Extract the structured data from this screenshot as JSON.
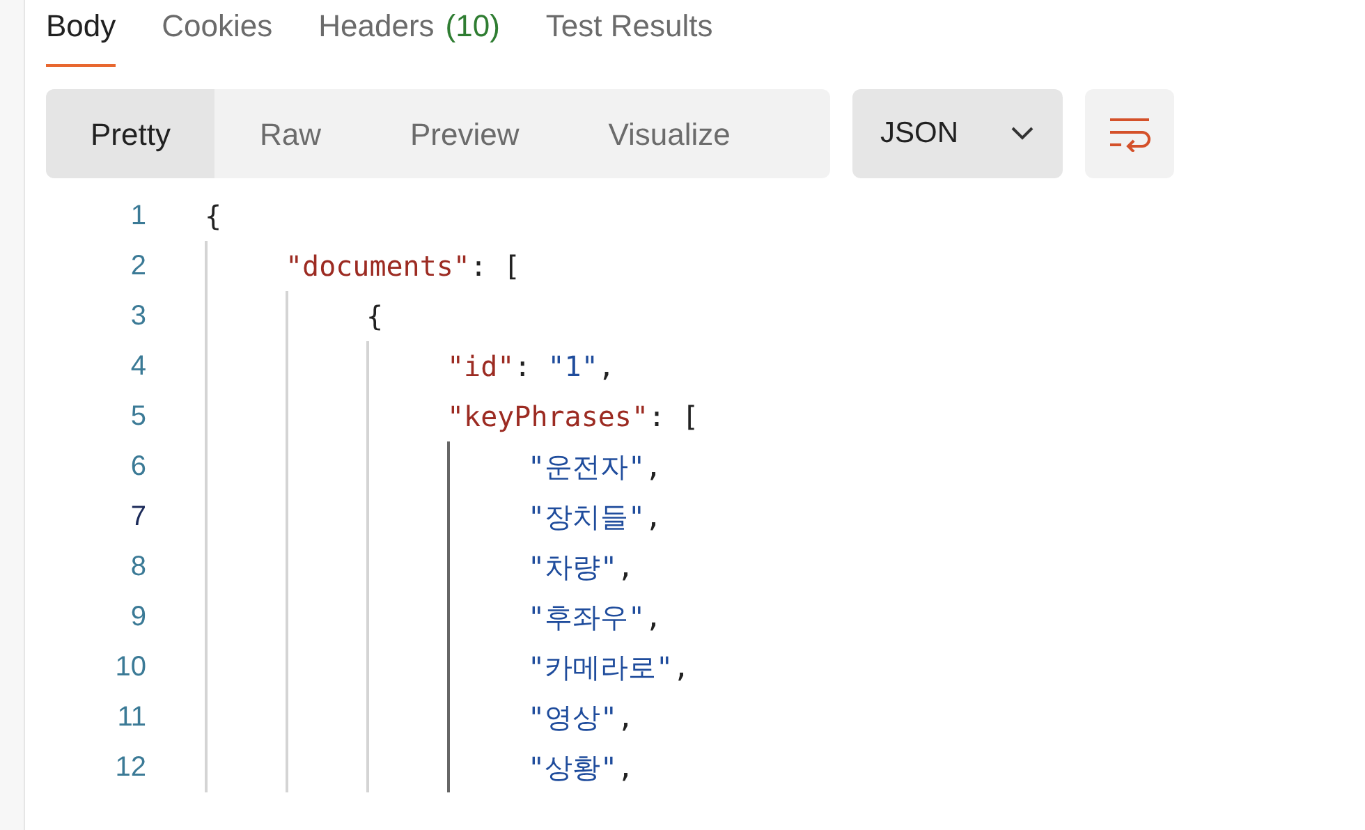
{
  "tabs": [
    {
      "label": "Body",
      "selected": true
    },
    {
      "label": "Cookies",
      "selected": false
    },
    {
      "label": "Headers",
      "count": "(10)",
      "selected": false
    },
    {
      "label": "Test Results",
      "selected": false
    }
  ],
  "view_modes": [
    {
      "label": "Pretty",
      "selected": true
    },
    {
      "label": "Raw",
      "selected": false
    },
    {
      "label": "Preview",
      "selected": false
    },
    {
      "label": "Visualize",
      "selected": false
    }
  ],
  "format_dropdown": {
    "value": "JSON"
  },
  "code": [
    {
      "number": "1",
      "current": false,
      "tokens": [
        {
          "kind": "punct",
          "text": "{"
        }
      ],
      "children": [
        {
          "number": "2",
          "current": false,
          "tokens": [
            {
              "kind": "key",
              "text": "\"documents\""
            },
            {
              "kind": "punct",
              "text": ": ["
            }
          ],
          "children": [
            {
              "number": "3",
              "current": false,
              "tokens": [
                {
                  "kind": "punct",
                  "text": "{"
                }
              ],
              "children": [
                {
                  "number": "4",
                  "current": false,
                  "tokens": [
                    {
                      "kind": "key",
                      "text": "\"id\""
                    },
                    {
                      "kind": "punct",
                      "text": ": "
                    },
                    {
                      "kind": "string",
                      "text": "\"1\""
                    },
                    {
                      "kind": "punct",
                      "text": ","
                    }
                  ]
                },
                {
                  "number": "5",
                  "current": false,
                  "tokens": [
                    {
                      "kind": "key",
                      "text": "\"keyPhrases\""
                    },
                    {
                      "kind": "punct",
                      "text": ": ["
                    }
                  ],
                  "children": [
                    {
                      "number": "6",
                      "current": false,
                      "tokens": [
                        {
                          "kind": "string",
                          "text": "\"운전자\""
                        },
                        {
                          "kind": "punct",
                          "text": ","
                        }
                      ]
                    },
                    {
                      "number": "7",
                      "current": true,
                      "tokens": [
                        {
                          "kind": "string",
                          "text": "\"장치들\""
                        },
                        {
                          "kind": "punct",
                          "text": ","
                        }
                      ]
                    },
                    {
                      "number": "8",
                      "current": false,
                      "tokens": [
                        {
                          "kind": "string",
                          "text": "\"차량\""
                        },
                        {
                          "kind": "punct",
                          "text": ","
                        }
                      ]
                    },
                    {
                      "number": "9",
                      "current": false,
                      "tokens": [
                        {
                          "kind": "string",
                          "text": "\"후좌우\""
                        },
                        {
                          "kind": "punct",
                          "text": ","
                        }
                      ]
                    },
                    {
                      "number": "10",
                      "current": false,
                      "tokens": [
                        {
                          "kind": "string",
                          "text": "\"카메라로\""
                        },
                        {
                          "kind": "punct",
                          "text": ","
                        }
                      ]
                    },
                    {
                      "number": "11",
                      "current": false,
                      "tokens": [
                        {
                          "kind": "string",
                          "text": "\"영상\""
                        },
                        {
                          "kind": "punct",
                          "text": ","
                        }
                      ]
                    },
                    {
                      "number": "12",
                      "current": false,
                      "tokens": [
                        {
                          "kind": "string",
                          "text": "\"상황\""
                        },
                        {
                          "kind": "punct",
                          "text": ","
                        }
                      ]
                    }
                  ]
                }
              ]
            }
          ]
        }
      ]
    }
  ]
}
